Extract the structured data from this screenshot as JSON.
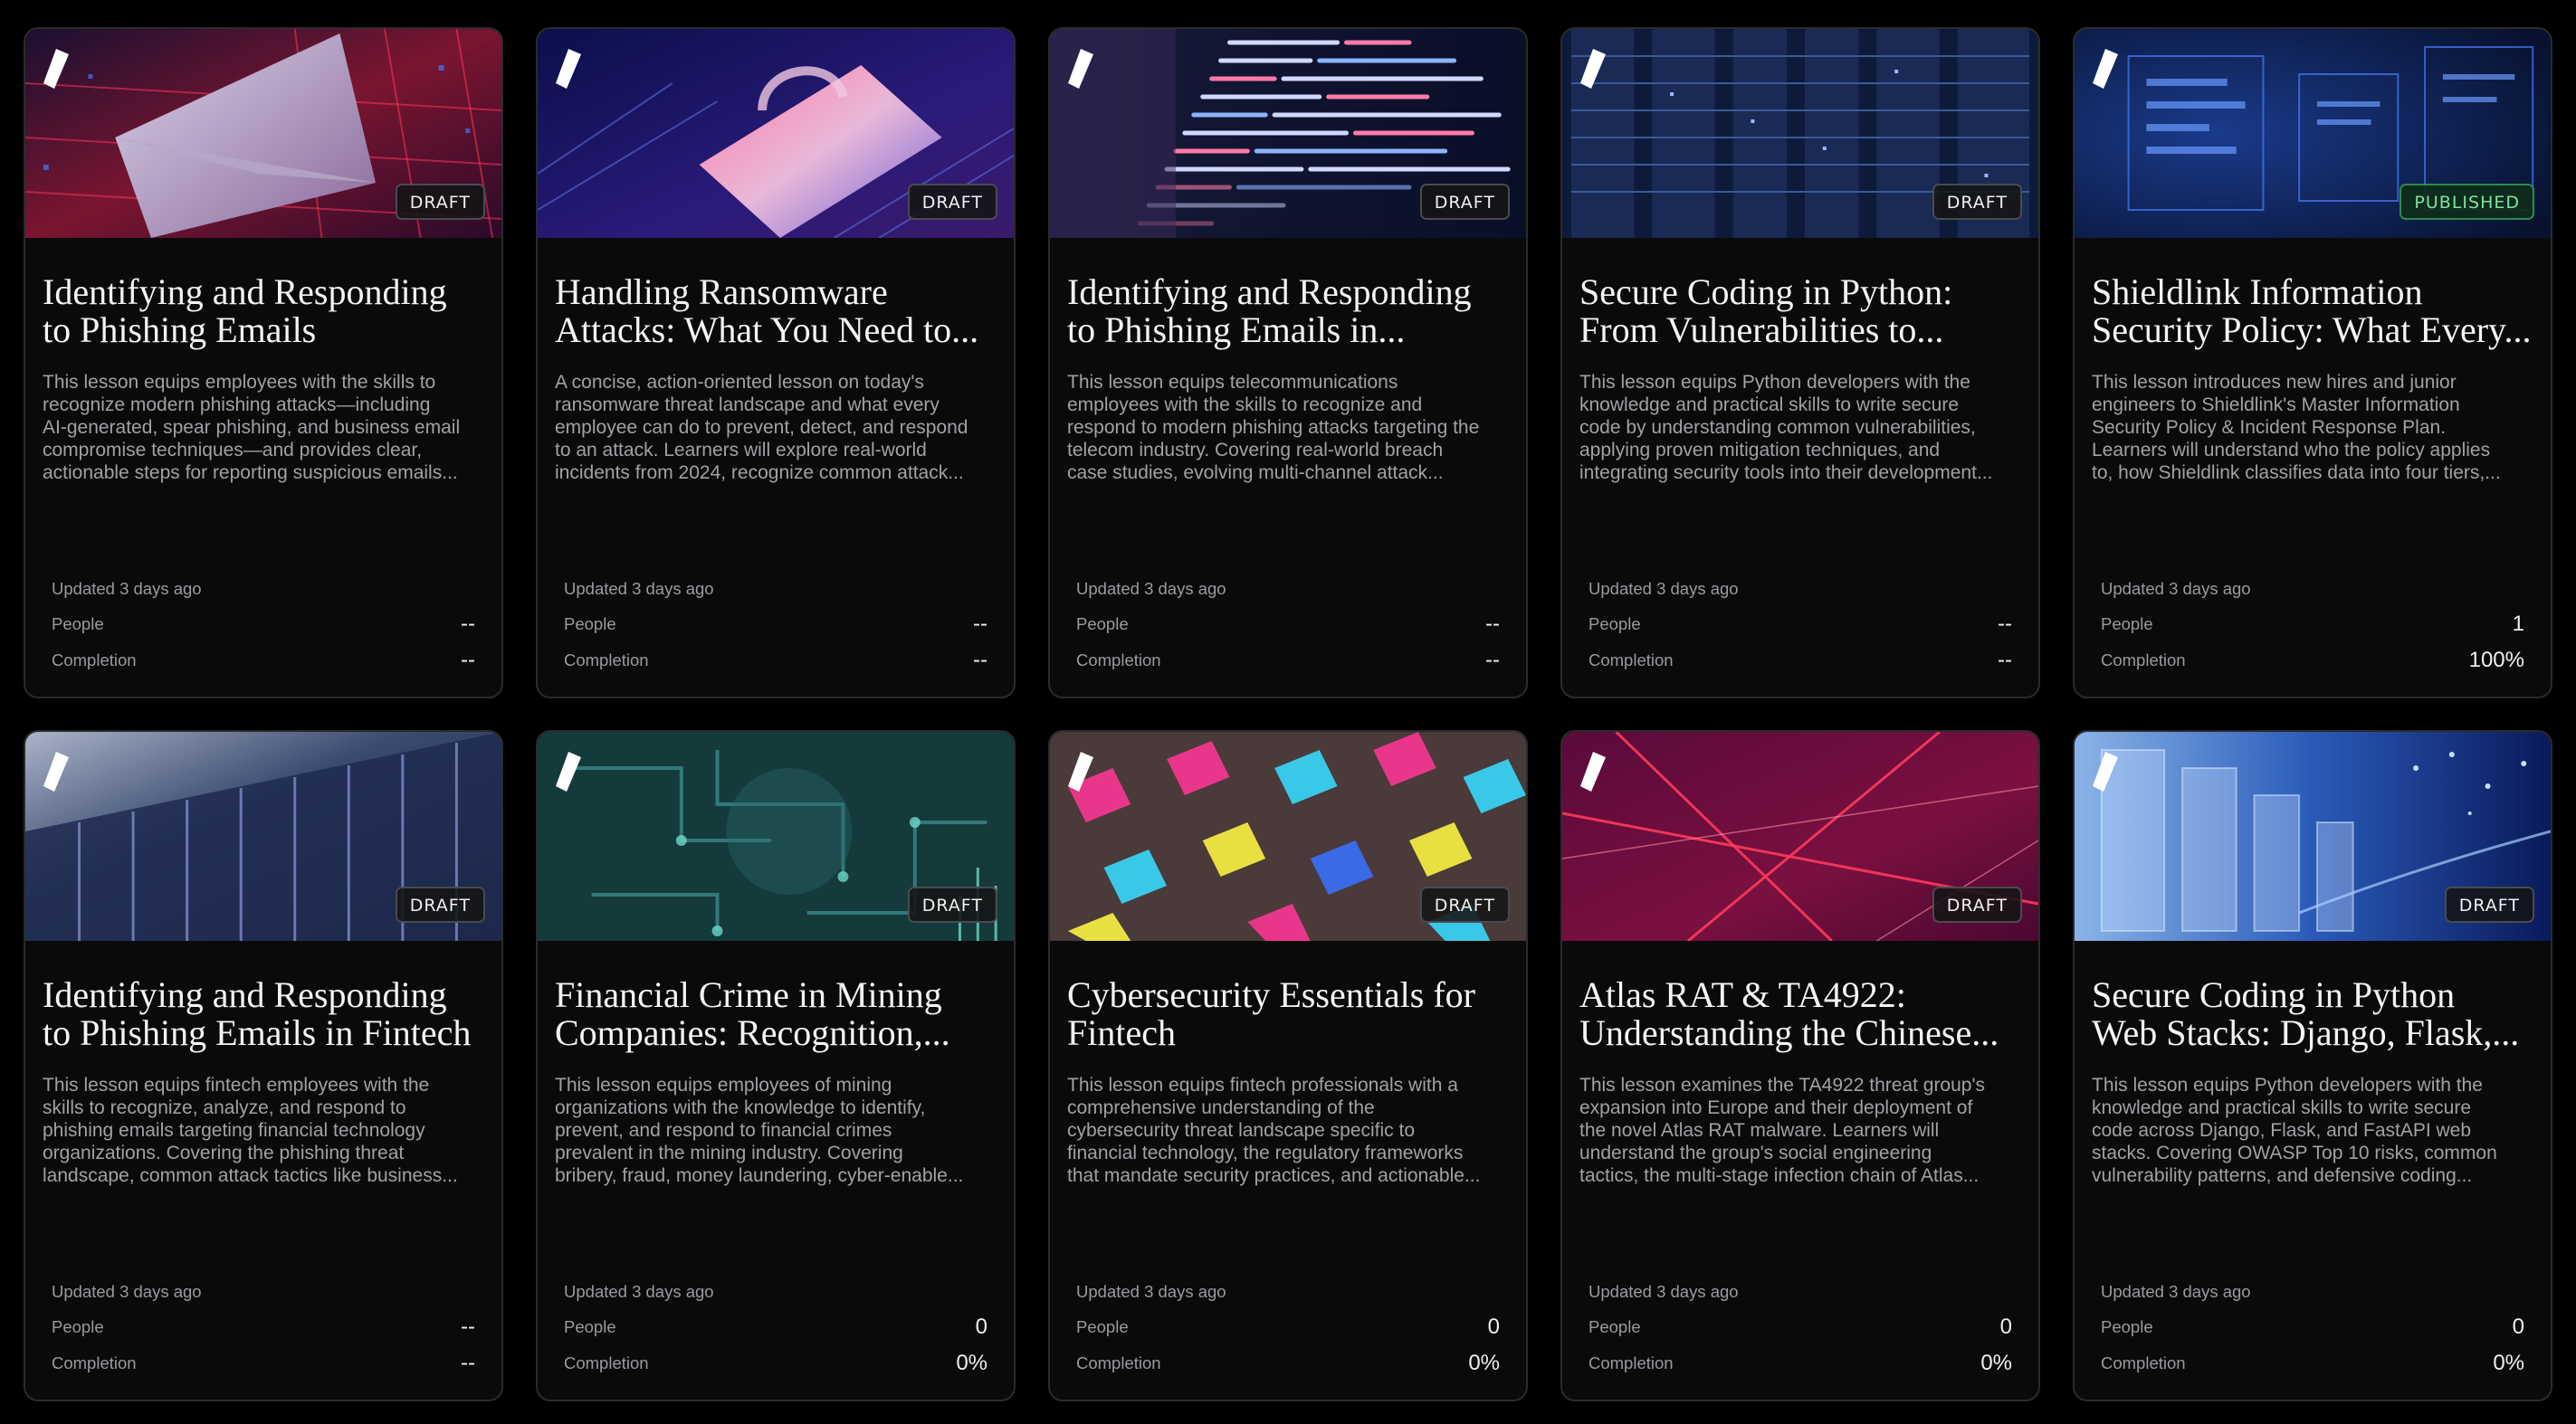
{
  "labels": {
    "people": "People",
    "completion": "Completion"
  },
  "cards": [
    {
      "status": "DRAFT",
      "title": "Identifying and Responding\nto Phishing Emails",
      "description": "This lesson equips employees with the skills to\nrecognize modern phishing attacks—including\nAI-generated, spear phishing, and business email\ncompromise techniques—and provides clear,\nactionable steps for reporting suspicious emails...",
      "updated": "Updated 3 days ago",
      "people": "--",
      "completion": "--",
      "image_icon": "envelope-image-icon"
    },
    {
      "status": "DRAFT",
      "title": "Handling Ransomware\nAttacks: What You Need to...",
      "description": "A concise, action-oriented lesson on today's\nransomware threat landscape and what every\nemployee can do to prevent, detect, and respond\nto an attack. Learners will explore real-world\nincidents from 2024, recognize common attack...",
      "updated": "Updated 3 days ago",
      "people": "--",
      "completion": "--",
      "image_icon": "locked-phone-image-icon"
    },
    {
      "status": "DRAFT",
      "title": "Identifying and Responding\nto Phishing Emails in...",
      "description": "This lesson equips telecommunications\nemployees with the skills to recognize and\nrespond to modern phishing attacks targeting the\ntelecom industry. Covering real-world breach\ncase studies, evolving multi-channel attack...",
      "updated": "Updated 3 days ago",
      "people": "--",
      "completion": "--",
      "image_icon": "code-screen-image-icon"
    },
    {
      "status": "DRAFT",
      "title": "Secure Coding in Python:\nFrom Vulnerabilities to...",
      "description": "This lesson equips Python developers with the\nknowledge and practical skills to write secure\ncode by understanding common vulnerabilities,\napplying proven mitigation techniques, and\nintegrating security tools into their development...",
      "updated": "Updated 3 days ago",
      "people": "--",
      "completion": "--",
      "image_icon": "server-racks-image-icon"
    },
    {
      "status": "PUBLISHED",
      "title": "Shieldlink Information\nSecurity Policy: What Every...",
      "description": "This lesson introduces new hires and junior\nengineers to Shieldlink's Master Information\nSecurity Policy & Incident Response Plan.\nLearners will understand who the policy applies\nto, how Shieldlink classifies data into four tiers,...",
      "updated": "Updated 3 days ago",
      "people": "1",
      "completion": "100%",
      "image_icon": "digital-documents-image-icon"
    },
    {
      "status": "DRAFT",
      "title": "Identifying and Responding\nto Phishing Emails in Fintech",
      "description": "This lesson equips fintech employees with the\nskills to recognize, analyze, and respond to\nphishing emails targeting financial technology\norganizations. Covering the phishing threat\nlandscape, common attack tactics like business...",
      "updated": "Updated 3 days ago",
      "people": "--",
      "completion": "--",
      "image_icon": "glass-building-image-icon"
    },
    {
      "status": "DRAFT",
      "title": "Financial Crime in Mining\nCompanies: Recognition,...",
      "description": "This lesson equips employees of mining\norganizations with the knowledge to identify,\nprevent, and respond to financial crimes\nprevalent in the mining industry. Covering\nbribery, fraud, money laundering, cyber-enable...",
      "updated": "Updated 3 days ago",
      "people": "0",
      "completion": "0%",
      "image_icon": "circuit-board-image-icon"
    },
    {
      "status": "DRAFT",
      "title": "Cybersecurity Essentials for\nFintech",
      "description": "This lesson equips fintech professionals with a\ncomprehensive understanding of the\ncybersecurity threat landscape specific to\nfinancial technology, the regulatory frameworks\nthat mandate security practices, and actionable...",
      "updated": "Updated 3 days ago",
      "people": "0",
      "completion": "0%",
      "image_icon": "colorful-laptops-image-icon"
    },
    {
      "status": "DRAFT",
      "title": "Atlas RAT & TA4922:\nUnderstanding the Chinese...",
      "description": "This lesson examines the TA4922 threat group's\nexpansion into Europe and their deployment of\nthe novel Atlas RAT malware. Learners will\nunderstand the group's social engineering\ntactics, the multi-stage infection chain of Atlas...",
      "updated": "Updated 3 days ago",
      "people": "0",
      "completion": "0%",
      "image_icon": "red-light-rays-image-icon"
    },
    {
      "status": "DRAFT",
      "title": "Secure Coding in Python\nWeb Stacks: Django, Flask,...",
      "description": "This lesson equips Python developers with the\nknowledge and practical skills to write secure\ncode across Django, Flask, and FastAPI web\nstacks. Covering OWASP Top 10 risks, common\nvulnerability patterns, and defensive coding...",
      "updated": "Updated 3 days ago",
      "people": "0",
      "completion": "0%",
      "image_icon": "data-panels-image-icon"
    }
  ]
}
